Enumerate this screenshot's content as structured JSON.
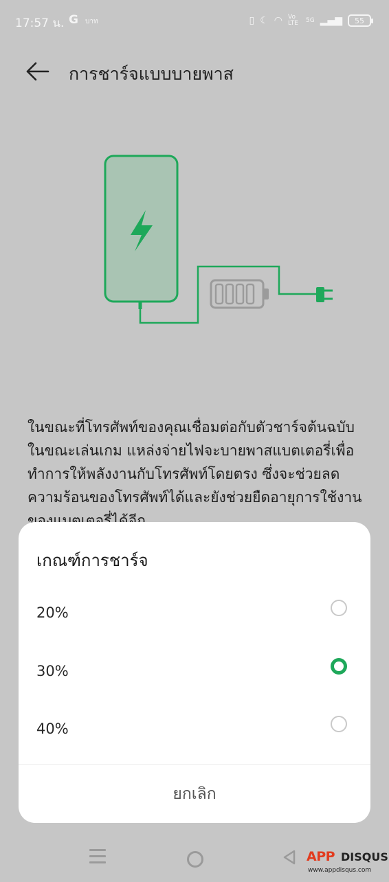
{
  "status_bar": {
    "time": "17:57 น.",
    "google": "G",
    "extra": "บาท",
    "network": "Vo LTE",
    "signal": "5G",
    "battery": "55"
  },
  "header": {
    "title": "การชาร์จแบบบายพาส"
  },
  "description": "ในขณะที่โทรศัพท์ของคุณเชื่อมต่อกับตัวชาร์จต้นฉบับในขณะเล่นเกม แหล่งจ่ายไฟจะบายพาสแบตเตอรี่เพื่อทำการให้พลังงานกับโทรศัพท์โดยตรง ซึ่งจะช่วยลดความร้อนของโทรศัพท์ได้และยังช่วยยืดอายุการใช้งานของแบตเตอรี่ได้อีก",
  "sheet": {
    "title": "เกณฑ์การชาร์จ",
    "options": [
      {
        "label": "20%",
        "selected": false
      },
      {
        "label": "30%",
        "selected": true
      },
      {
        "label": "40%",
        "selected": false
      }
    ],
    "cancel": "ยกเลิก"
  },
  "watermark": {
    "brand_a": "APP",
    "brand_b": "DISQUS",
    "url": "www.appdisqus.com"
  },
  "colors": {
    "accent": "#1ea85a",
    "background": "#c6c6c6"
  }
}
